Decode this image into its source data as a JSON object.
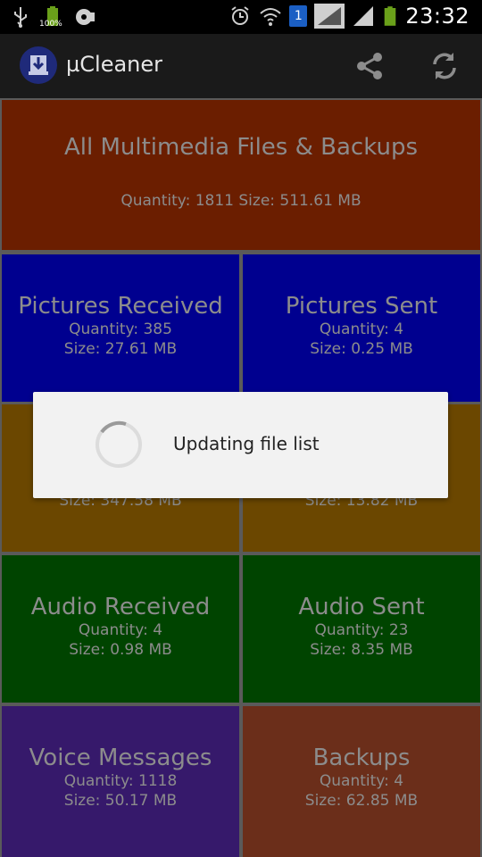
{
  "statusbar": {
    "battery_text": "100%",
    "time": "23:32",
    "sim_badge": "1"
  },
  "app": {
    "title": "µCleaner"
  },
  "tiles": {
    "all": {
      "title": "All Multimedia Files & Backups",
      "summary": "Quantity: 1811 Size: 511.61 MB"
    },
    "pictures_received": {
      "title": "Pictures Received",
      "quantity": "Quantity: 385",
      "size": "Size: 27.61 MB"
    },
    "pictures_sent": {
      "title": "Pictures Sent",
      "quantity": "Quantity: 4",
      "size": "Size: 0.25 MB"
    },
    "videos_received": {
      "size": "Size: 347.58 MB"
    },
    "videos_sent": {
      "size": "Size: 13.82 MB"
    },
    "audio_received": {
      "title": "Audio Received",
      "quantity": "Quantity: 4",
      "size": "Size: 0.98 MB"
    },
    "audio_sent": {
      "title": "Audio Sent",
      "quantity": "Quantity: 23",
      "size": "Size: 8.35 MB"
    },
    "voice_messages": {
      "title": "Voice Messages",
      "quantity": "Quantity: 1118",
      "size": "Size: 50.17 MB"
    },
    "backups": {
      "title": "Backups",
      "quantity": "Quantity: 4",
      "size": "Size: 62.85 MB"
    }
  },
  "dialog": {
    "message": "Updating file list"
  },
  "colors": {
    "all": "#6b1e00",
    "pictures": "#00008f",
    "videos": "#6b4700",
    "audio": "#004400",
    "voice": "#36196b",
    "backups": "#6b2e1a"
  },
  "icons": [
    "usb-icon",
    "battery-full-icon",
    "media-icon",
    "alarm-icon",
    "wifi-icon",
    "sim-1-icon",
    "signal-icon",
    "signal-2-icon",
    "battery-icon",
    "app-logo-icon",
    "share-icon",
    "refresh-icon",
    "loading-spinner-icon"
  ]
}
